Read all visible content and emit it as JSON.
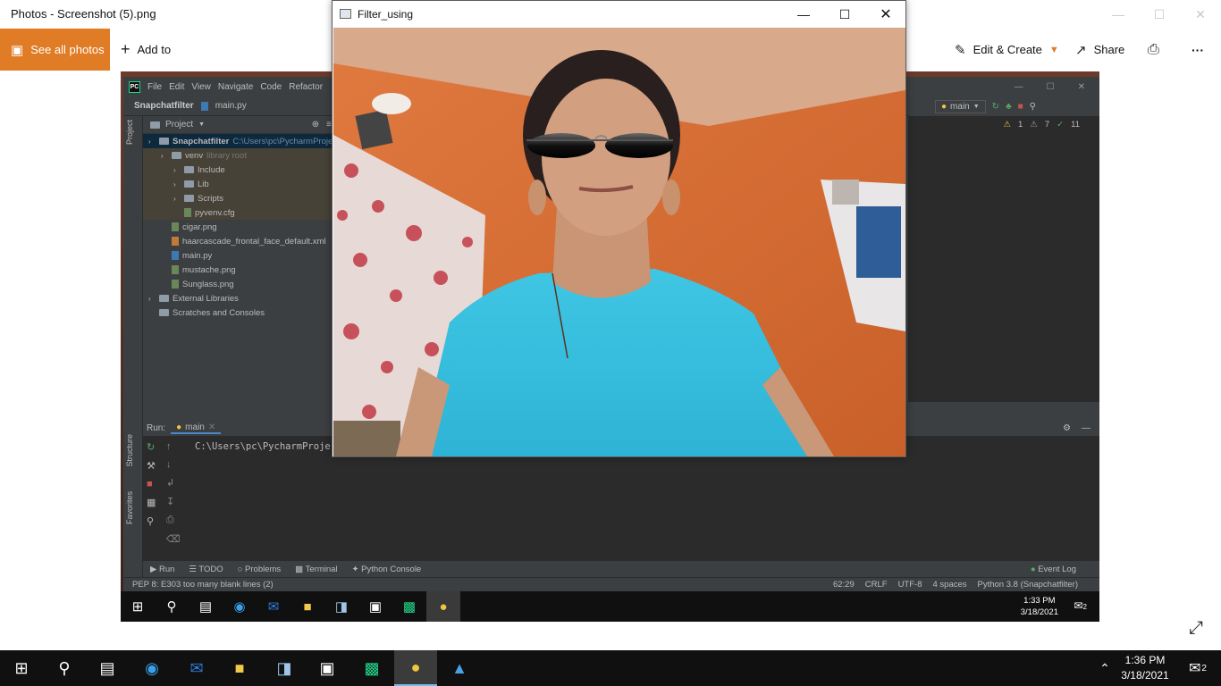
{
  "photos": {
    "title": "Photos - Screenshot (5).png",
    "see_all": "See all photos",
    "add_to": "Add to",
    "edit_create": "Edit & Create",
    "share": "Share",
    "more": "···"
  },
  "pycharm": {
    "menu": [
      "File",
      "Edit",
      "View",
      "Navigate",
      "Code",
      "Refactor"
    ],
    "breadcrumb_project": "Snapchatfilter",
    "breadcrumb_file": "main.py",
    "project_label": "Project",
    "run_config": "main",
    "inspections": {
      "warnings": "1",
      "weak": "7",
      "ok": "11"
    },
    "tree": [
      {
        "label": "Snapchatfilter",
        "extra": "C:\\Users\\pc\\PycharmProje",
        "kind": "folder",
        "indent": 0,
        "selected": true
      },
      {
        "label": "venv",
        "extra": "library root",
        "kind": "folder",
        "indent": 1
      },
      {
        "label": "Include",
        "kind": "folder",
        "indent": 2
      },
      {
        "label": "Lib",
        "kind": "folder",
        "indent": 2
      },
      {
        "label": "Scripts",
        "kind": "folder",
        "indent": 2
      },
      {
        "label": "pyvenv.cfg",
        "kind": "file",
        "indent": 2
      },
      {
        "label": "cigar.png",
        "kind": "file",
        "indent": 1
      },
      {
        "label": "haarcascade_frontal_face_default.xml",
        "kind": "xml",
        "indent": 1
      },
      {
        "label": "main.py",
        "kind": "py",
        "indent": 1
      },
      {
        "label": "mustache.png",
        "kind": "file",
        "indent": 1
      },
      {
        "label": "Sunglass.png",
        "kind": "file",
        "indent": 1
      },
      {
        "label": "External Libraries",
        "kind": "folder",
        "indent": 0
      },
      {
        "label": "Scratches and Consoles",
        "kind": "folder",
        "indent": 0
      }
    ],
    "side_tabs": {
      "project": "Project",
      "structure": "Structure",
      "favorites": "Favorites"
    },
    "run_label": "Run:",
    "run_tab": "main",
    "run_output": "C:\\Users\\pc\\PycharmProje",
    "bottom_tabs": [
      "Run",
      "TODO",
      "Problems",
      "Terminal",
      "Python Console"
    ],
    "event_log": "Event Log",
    "status_msg": "PEP 8: E303 too many blank lines (2)",
    "status_right": [
      "62:29",
      "CRLF",
      "UTF-8",
      "4 spaces",
      "Python 3.8 (Snapchatfilter)"
    ],
    "inner_clock_time": "1:33 PM",
    "inner_clock_date": "3/18/2021",
    "inner_notifications": "2"
  },
  "cv_window": {
    "title": "Filter_using"
  },
  "taskbar": {
    "time": "1:36 PM",
    "date": "3/18/2021",
    "notifications": "2"
  }
}
